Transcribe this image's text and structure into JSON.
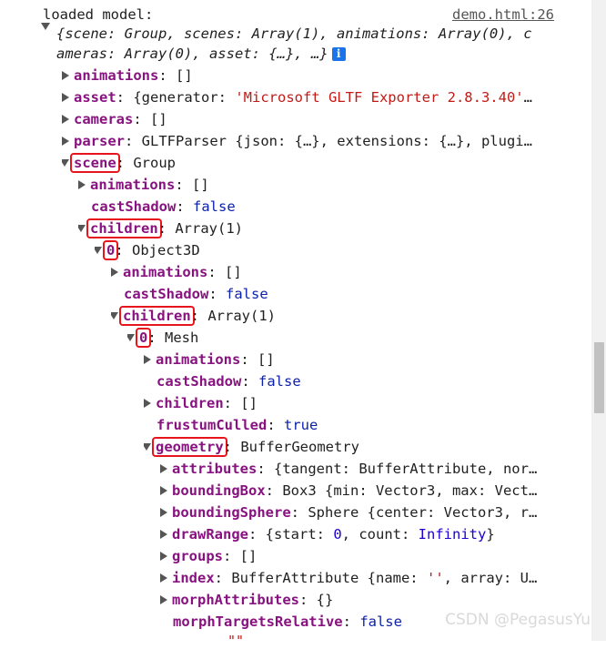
{
  "console": {
    "message": "loaded model:",
    "source_link": "demo.html:26",
    "summary_line1": "{scene: Group, scenes: Array(1), animations: Array(0), c",
    "summary_line2": "ameras: Array(0), asset: {…}, …}"
  },
  "rows": {
    "animations_key": "animations",
    "animations_val": "[]",
    "asset_key": "asset",
    "asset_val_pre": "{generator: ",
    "asset_val_str": "'Microsoft GLTF Exporter 2.8.3.40'",
    "asset_val_post": "…",
    "cameras_key": "cameras",
    "cameras_val": "[]",
    "parser_key": "parser",
    "parser_val": "GLTFParser {json: {…}, extensions: {…}, plugi…",
    "scene_key": "scene",
    "scene_val": "Group",
    "s_animations_key": "animations",
    "s_animations_val": "[]",
    "s_castShadow_key": "castShadow",
    "s_castShadow_val": "false",
    "s_children_key": "children",
    "s_children_val": "Array(1)",
    "c0_key": "0",
    "c0_val": "Object3D",
    "c0_animations_key": "animations",
    "c0_animations_val": "[]",
    "c0_castShadow_key": "castShadow",
    "c0_castShadow_val": "false",
    "c0_children_key": "children",
    "c0_children_val": "Array(1)",
    "m0_key": "0",
    "m0_val": "Mesh",
    "m_animations_key": "animations",
    "m_animations_val": "[]",
    "m_castShadow_key": "castShadow",
    "m_castShadow_val": "false",
    "m_children_key": "children",
    "m_children_val": "[]",
    "m_frustum_key": "frustumCulled",
    "m_frustum_val": "true",
    "m_geometry_key": "geometry",
    "m_geometry_val": "BufferGeometry",
    "g_attributes_key": "attributes",
    "g_attributes_val": "{tangent: BufferAttribute, nor…",
    "g_bbox_key": "boundingBox",
    "g_bbox_val": "Box3 {min: Vector3, max: Vect…",
    "g_bsphere_key": "boundingSphere",
    "g_bsphere_val": "Sphere {center: Vector3, r…",
    "g_draw_key": "drawRange",
    "g_draw_pre": "{start: ",
    "g_draw_start": "0",
    "g_draw_mid": ", count: ",
    "g_draw_count": "Infinity",
    "g_draw_post": "}",
    "g_groups_key": "groups",
    "g_groups_val": "[]",
    "g_index_key": "index",
    "g_index_pre": "BufferAttribute {name: ",
    "g_index_str": "''",
    "g_index_post": ", array: U…",
    "g_morph_key": "morphAttributes",
    "g_morph_val": "{}",
    "g_mtr_key": "morphTargetsRelative",
    "g_mtr_val": "false",
    "cut_off_text": "\"\""
  },
  "watermark": "CSDN @PegasusYu"
}
